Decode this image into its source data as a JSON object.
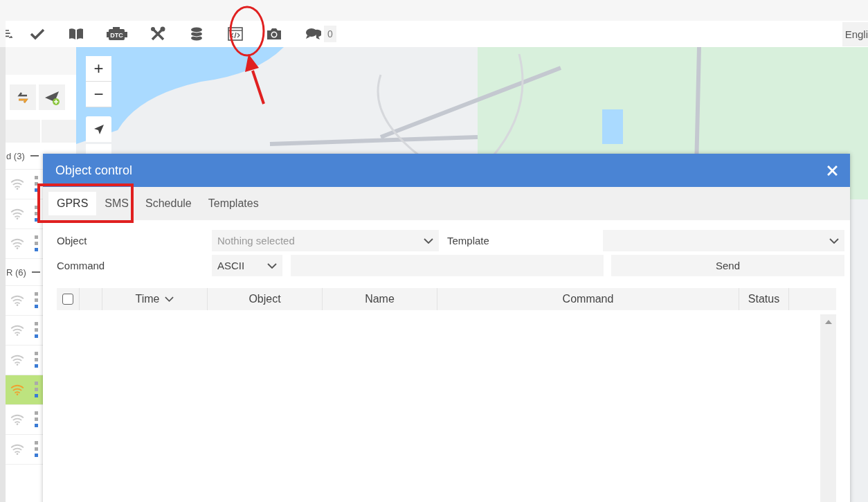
{
  "toolbar": {
    "engine_label": "DTC",
    "chat_count": "0",
    "language": "Engli"
  },
  "map": {
    "zoom_in": "+",
    "zoom_out": "−"
  },
  "sidebar": {
    "groups": [
      {
        "label": "d (3)",
        "expanded": true,
        "rows": [
          {
            "selected": false
          },
          {
            "selected": false
          },
          {
            "selected": false
          }
        ]
      },
      {
        "label": "R (6)",
        "expanded": true,
        "rows": [
          {
            "selected": false
          },
          {
            "selected": false
          },
          {
            "selected": false
          },
          {
            "selected": true
          },
          {
            "selected": false
          },
          {
            "selected": false
          }
        ]
      }
    ]
  },
  "dialog": {
    "title": "Object control",
    "tabs": [
      {
        "label": "GPRS",
        "selected": true
      },
      {
        "label": "SMS",
        "selected": false
      },
      {
        "label": "Schedule",
        "selected": false
      },
      {
        "label": "Templates",
        "selected": false
      }
    ],
    "form": {
      "object_label": "Object",
      "object_placeholder": "Nothing selected",
      "template_label": "Template",
      "command_label": "Command",
      "encoding": "ASCII",
      "send": "Send"
    },
    "table": {
      "select_all_checked": false,
      "columns": [
        {
          "label": "Time",
          "sorted": true
        },
        {
          "label": "Object",
          "sorted": false
        },
        {
          "label": "Name",
          "sorted": false
        },
        {
          "label": "Command",
          "sorted": false
        },
        {
          "label": "Status",
          "sorted": false
        }
      ]
    }
  }
}
